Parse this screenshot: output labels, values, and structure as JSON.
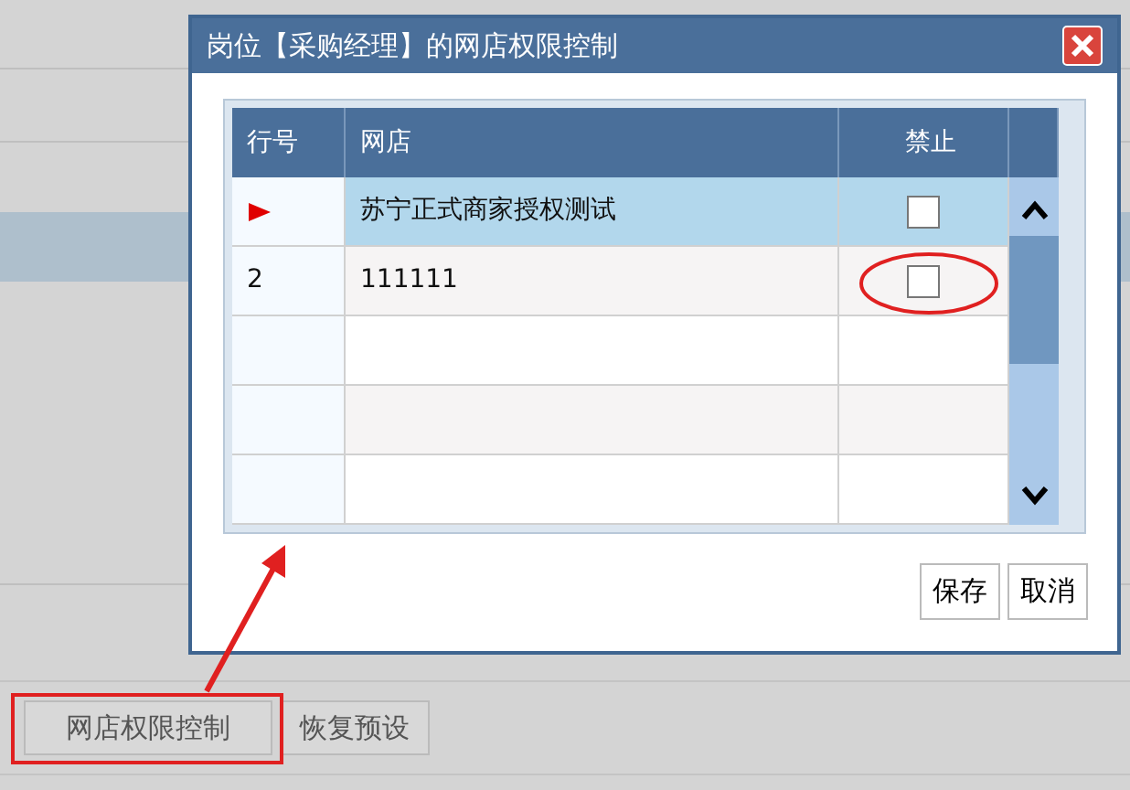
{
  "dialog": {
    "title": "岗位【采购经理】的网店权限控制",
    "grid": {
      "columns": [
        "行号",
        "网店",
        "禁止"
      ],
      "rows": [
        {
          "selected": true,
          "shop": "苏宁正式商家授权测试",
          "banned": false
        },
        {
          "number": "2",
          "selected": false,
          "shop": "111111",
          "banned": false
        }
      ]
    },
    "buttons": [
      "保存",
      "取消"
    ]
  },
  "toolbar": {
    "buttons": [
      "网店权限控制",
      "恢复预设"
    ]
  }
}
